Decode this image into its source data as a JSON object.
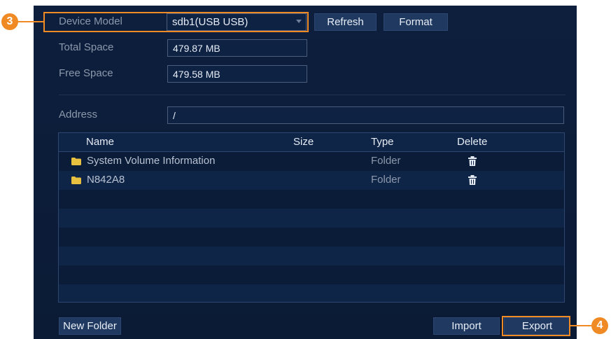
{
  "storage": {
    "device_model_label": "Device Model",
    "device_model_value": "sdb1(USB USB)",
    "refresh_label": "Refresh",
    "format_label": "Format",
    "total_space_label": "Total Space",
    "total_space_value": "479.87 MB",
    "free_space_label": "Free Space",
    "free_space_value": "479.58 MB",
    "address_label": "Address",
    "address_value": "/"
  },
  "file_list": {
    "columns": [
      "Name",
      "Size",
      "Type",
      "Delete"
    ],
    "rows": [
      {
        "name": "System Volume Information",
        "size": "",
        "type": "Folder",
        "icon": "folder-icon",
        "delete_icon": "trash-icon"
      },
      {
        "name": "N842A8",
        "size": "",
        "type": "Folder",
        "icon": "folder-icon",
        "delete_icon": "trash-icon"
      }
    ]
  },
  "footer": {
    "new_folder_label": "New Folder",
    "import_label": "Import",
    "export_label": "Export"
  },
  "callouts": {
    "device_model": "3",
    "export": "4"
  },
  "colors": {
    "highlight": "#f08a24",
    "panel_bg": "#0d1f3d",
    "button_bg": "#203960"
  }
}
